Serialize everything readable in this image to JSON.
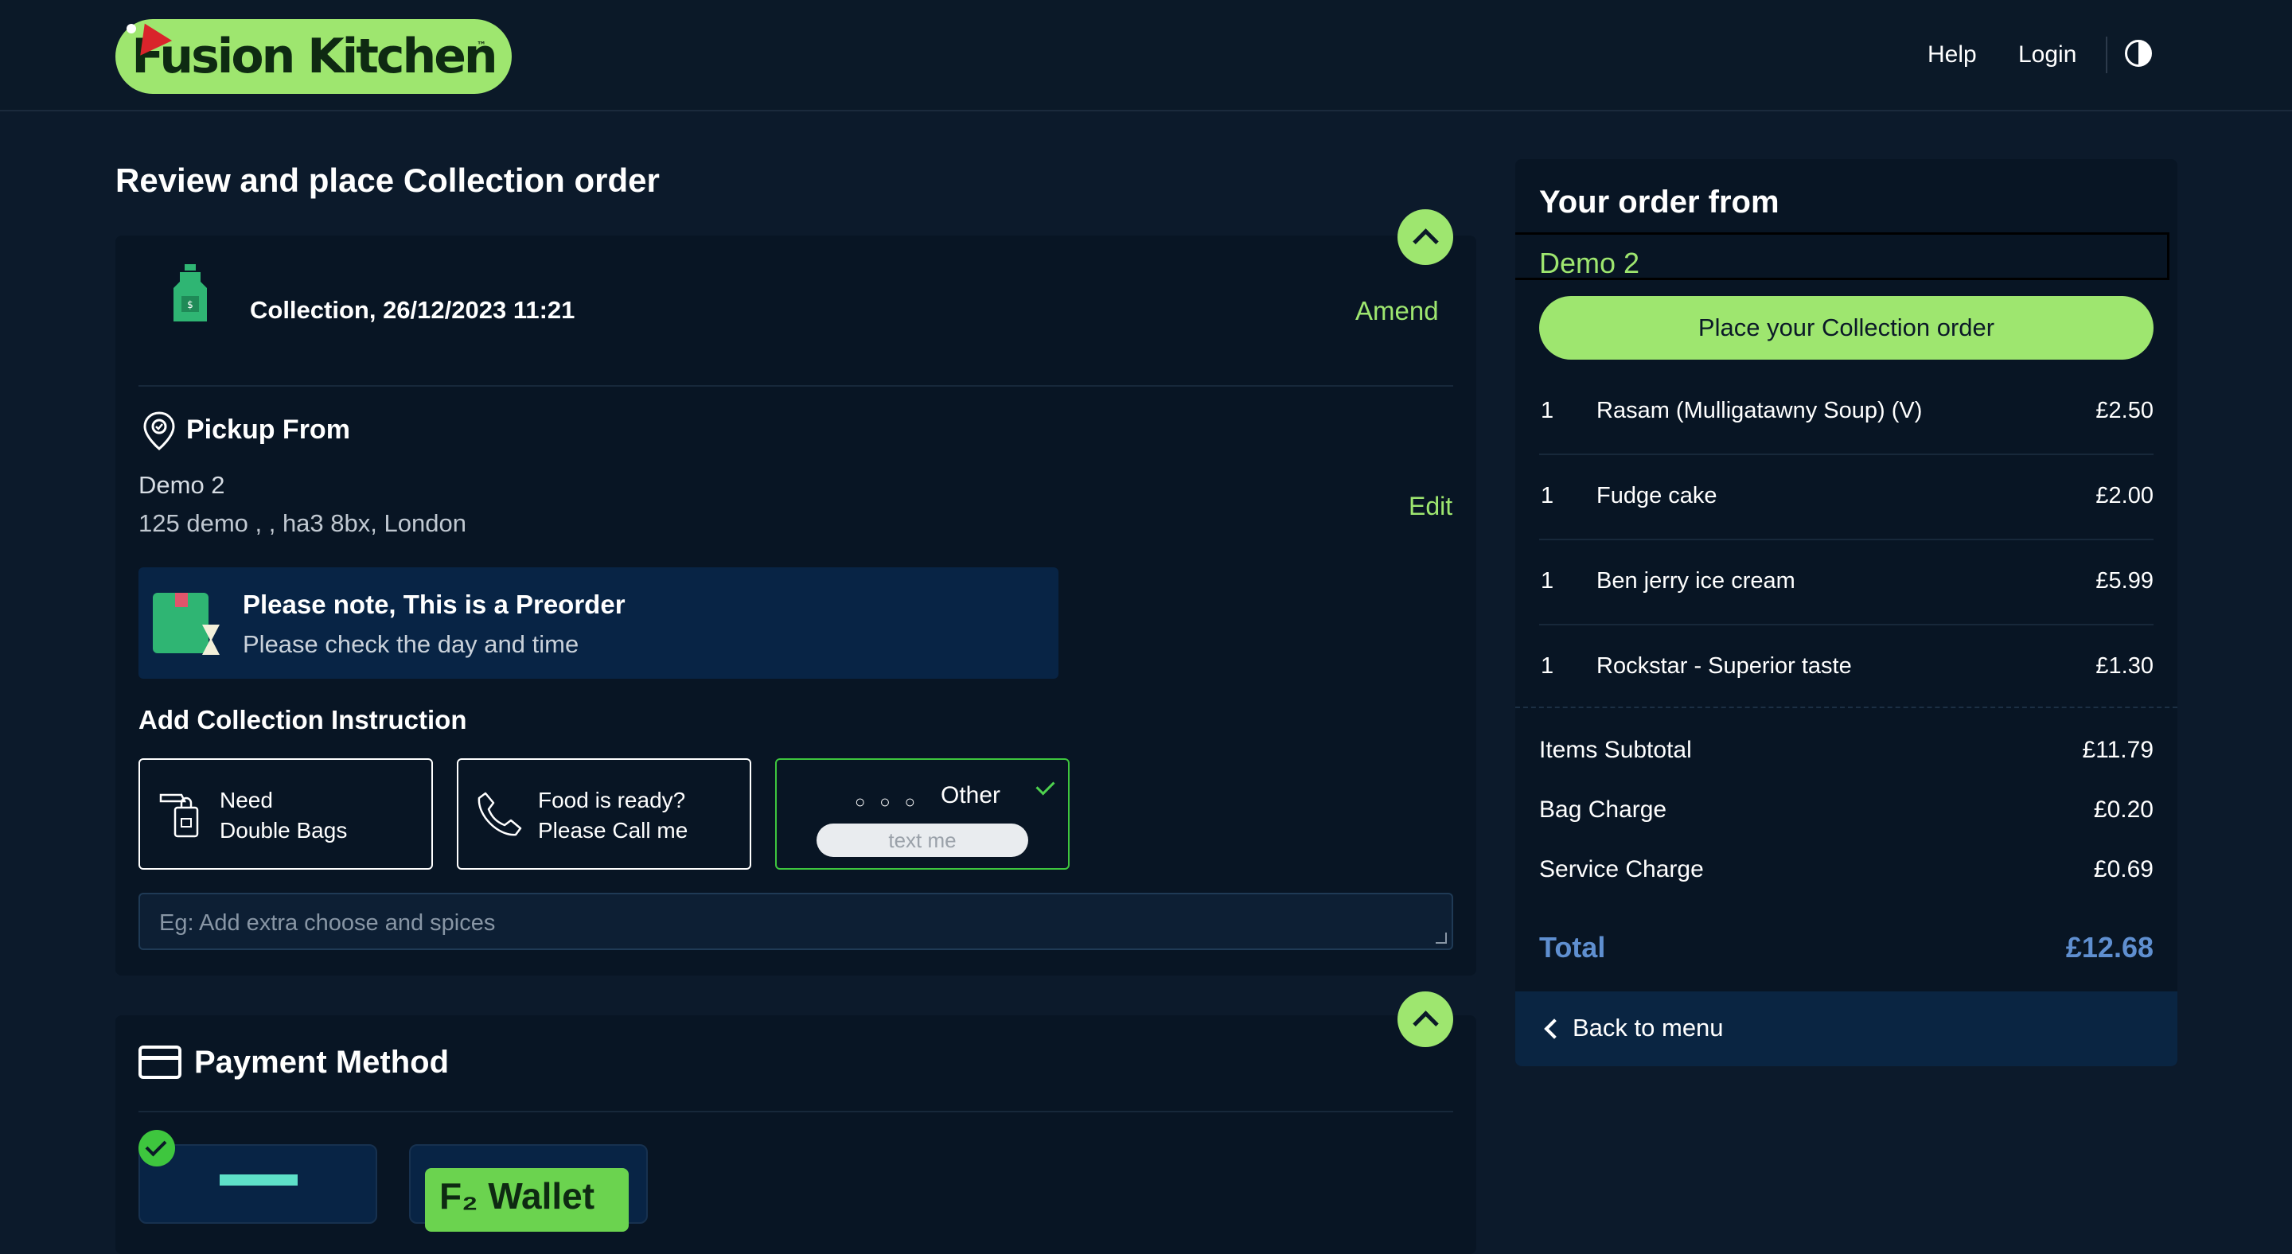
{
  "header": {
    "logo_text": "Fusion Kitchen",
    "nav": {
      "help": "Help",
      "login": "Login"
    }
  },
  "review": {
    "page_title": "Review and place Collection order",
    "collection_datetime": "Collection, 26/12/2023 11:21",
    "amend_label": "Amend",
    "pickup": {
      "title": "Pickup From",
      "store_name": "Demo 2",
      "address": "125 demo , , ha3 8bx, London",
      "edit_label": "Edit"
    },
    "preorder_note": {
      "title": "Please note, This is a Preorder",
      "subtitle": "Please check the day and time"
    },
    "instructions": {
      "title": "Add Collection Instruction",
      "options": [
        {
          "label_line1": "Need",
          "label_line2": "Double Bags",
          "selected": false
        },
        {
          "label_line1": "Food is ready?",
          "label_line2": "Please Call me",
          "selected": false
        },
        {
          "label": "Other",
          "pill": "text me",
          "selected": true
        }
      ],
      "input_placeholder": "Eg: Add extra choose and spices"
    }
  },
  "payment": {
    "title": "Payment Method",
    "wallet_label": "F₂ Wallet"
  },
  "summary": {
    "title": "Your order from",
    "store": "Demo 2",
    "place_order_label": "Place your Collection order",
    "items": [
      {
        "qty": "1",
        "name": "Rasam (Mulligatawny Soup) (V)",
        "price": "£2.50"
      },
      {
        "qty": "1",
        "name": "Fudge cake",
        "price": "£2.00"
      },
      {
        "qty": "1",
        "name": "Ben jerry ice cream",
        "price": "£5.99"
      },
      {
        "qty": "1",
        "name": "Rockstar - Superior taste",
        "price": "£1.30"
      }
    ],
    "subtotal": {
      "label": "Items Subtotal",
      "value": "£11.79"
    },
    "bag_charge": {
      "label": "Bag Charge",
      "value": "£0.20"
    },
    "service_charge": {
      "label": "Service Charge",
      "value": "£0.69"
    },
    "total": {
      "label": "Total",
      "value": "£12.68"
    },
    "back_label": "Back to menu"
  },
  "colors": {
    "accent": "#9ee66f",
    "background": "#0c1a2b",
    "card": "#081524",
    "selected_border": "#3ec63e",
    "total_text": "#5f8fd0"
  }
}
